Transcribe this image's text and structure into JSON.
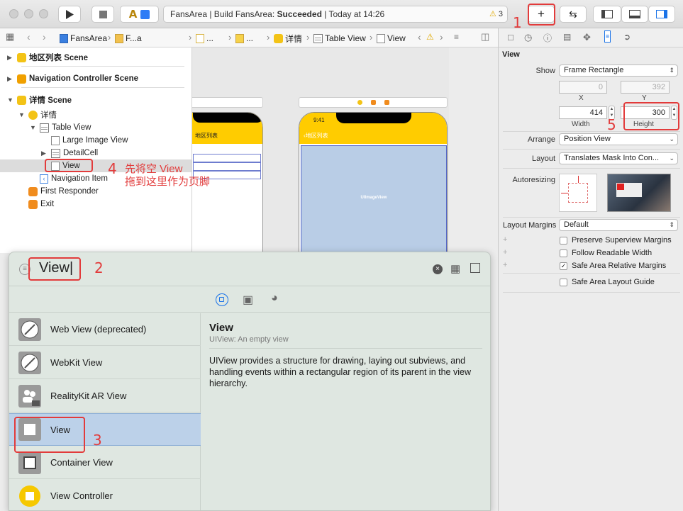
{
  "window": {
    "status_prefix": "FansArea | Build FansArea: ",
    "status_bold": "Succeeded",
    "status_suffix": " | Today at 14:26",
    "warning_count": "3"
  },
  "jumpbar": {
    "crumbs": [
      "FansArea",
      "F...a",
      "...",
      "...",
      "详情",
      "Table View",
      "View"
    ]
  },
  "outline": {
    "scene1": "地区列表 Scene",
    "scene2": "Navigation Controller Scene",
    "scene3": "详情 Scene",
    "item_detail": "详情",
    "item_tableview": "Table View",
    "item_largeimage": "Large Image View",
    "item_detailcell": "DetailCell",
    "item_view": "View",
    "item_navitem": "Navigation Item",
    "item_firstresponder": "First Responder",
    "item_exit": "Exit"
  },
  "canvas": {
    "left_phone_title": "地区列表",
    "right_phone_time": "9:41",
    "right_phone_back": "地区列表",
    "imageview_label": "UIImageView"
  },
  "inspector": {
    "title": "View",
    "show_label": "Show",
    "show_value": "Frame Rectangle",
    "x_value": "0",
    "y_value": "392",
    "x_label": "X",
    "y_label": "Y",
    "width_value": "414",
    "height_value": "300",
    "width_label": "Width",
    "height_label": "Height",
    "arrange_label": "Arrange",
    "arrange_value": "Position View",
    "layout_label": "Layout",
    "layout_value": "Translates Mask Into Con...",
    "autoresizing_label": "Autoresizing",
    "layout_margins_label": "Layout Margins",
    "layout_margins_value": "Default",
    "cb_preserve": "Preserve Superview Margins",
    "cb_readable": "Follow Readable Width",
    "cb_safe_relative": "Safe Area Relative Margins",
    "cb_safe_guide": "Safe Area Layout Guide",
    "safe_relative_checked": true
  },
  "library": {
    "search_value": "View",
    "detail_title": "View",
    "detail_subtitle": "UIView: An empty view",
    "detail_description": "UIView provides a structure for drawing, laying out subviews, and handling events within a rectangular region of its parent in the view hierarchy.",
    "items": [
      {
        "label": "Web View (deprecated)"
      },
      {
        "label": "WebKit View"
      },
      {
        "label": "RealityKit AR View"
      },
      {
        "label": "View"
      },
      {
        "label": "Container View"
      },
      {
        "label": "View Controller"
      }
    ]
  },
  "annotations": {
    "n1": "1",
    "n2": "2",
    "n3": "3",
    "n4": "4",
    "n5": "5",
    "note4_line1": "先将空 View",
    "note4_line2": "拖到这里作为页脚"
  },
  "colors": {
    "annotation_red": "#e23b3b",
    "phone_yellow": "#ffcc00",
    "imageview_blue": "#b9cde6",
    "selection_blue": "#bcd1e9"
  }
}
